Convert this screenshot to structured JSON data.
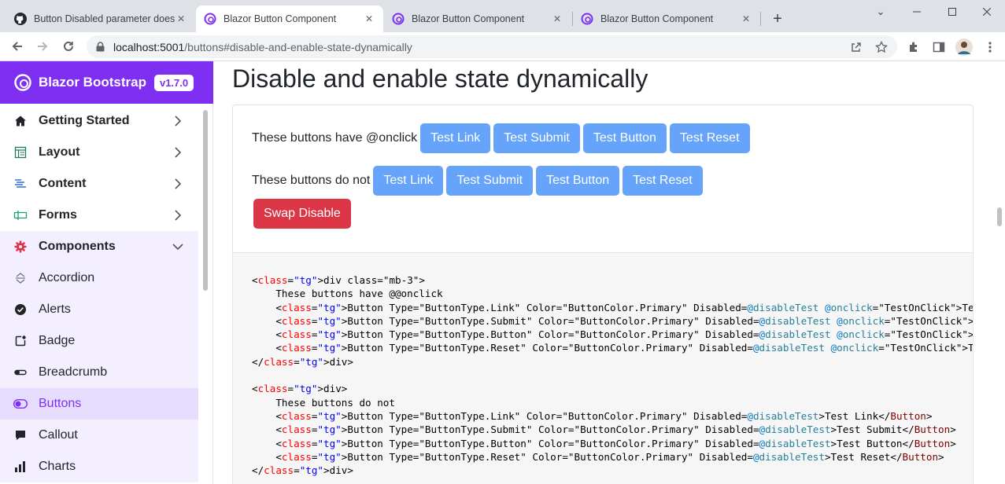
{
  "browser": {
    "tabs": [
      {
        "title": "Button Disabled parameter doesn't",
        "icon": "github-icon",
        "active": false
      },
      {
        "title": "Blazor Button Component",
        "icon": "blazor-icon",
        "active": true
      },
      {
        "title": "Blazor Button Component",
        "icon": "blazor-icon",
        "active": false
      },
      {
        "title": "Blazor Button Component",
        "icon": "blazor-icon",
        "active": false
      }
    ],
    "url_host": "localhost:5001",
    "url_path": "/buttons#disable-and-enable-state-dynamically"
  },
  "brand": {
    "name": "Blazor Bootstrap",
    "version": "v1.7.0",
    "color": "#7e2ff2"
  },
  "sidebar": {
    "items": [
      {
        "label": "Getting Started",
        "icon": "home-icon",
        "type": "group",
        "expanded": false
      },
      {
        "label": "Layout",
        "icon": "layout-icon",
        "type": "group",
        "expanded": false
      },
      {
        "label": "Content",
        "icon": "content-icon",
        "type": "group",
        "expanded": false
      },
      {
        "label": "Forms",
        "icon": "forms-icon",
        "type": "group",
        "expanded": false
      },
      {
        "label": "Components",
        "icon": "gear-icon",
        "type": "group",
        "expanded": true
      },
      {
        "label": "Accordion",
        "icon": "accordion-icon",
        "type": "sub"
      },
      {
        "label": "Alerts",
        "icon": "check-circle-icon",
        "type": "sub"
      },
      {
        "label": "Badge",
        "icon": "badge-icon",
        "type": "sub"
      },
      {
        "label": "Breadcrumb",
        "icon": "breadcrumb-icon",
        "type": "sub"
      },
      {
        "label": "Buttons",
        "icon": "toggle-icon",
        "type": "sub",
        "active": true
      },
      {
        "label": "Callout",
        "icon": "callout-icon",
        "type": "sub"
      },
      {
        "label": "Charts",
        "icon": "bar-chart-icon",
        "type": "sub"
      }
    ]
  },
  "main": {
    "title": "Disable and enable state dynamically",
    "row1_label": "These buttons have @onclick",
    "row2_label": "These buttons do not",
    "buttons": [
      "Test Link",
      "Test Submit",
      "Test Button",
      "Test Reset"
    ],
    "swap_label": "Swap Disable",
    "primary_color": "#66a3fa",
    "danger_color": "#dc3545",
    "code_lines": [
      "<div class=\"mb-3\">",
      "    These buttons have @@onclick",
      "    <Button Type=\"ButtonType.Link\" Color=\"ButtonColor.Primary\" Disabled=@disableTest @onclick=\"TestOnClick\">Test",
      "    <Button Type=\"ButtonType.Submit\" Color=\"ButtonColor.Primary\" Disabled=@disableTest @onclick=\"TestOnClick\">Tes",
      "    <Button Type=\"ButtonType.Button\" Color=\"ButtonColor.Primary\" Disabled=@disableTest @onclick=\"TestOnClick\">Tes",
      "    <Button Type=\"ButtonType.Reset\" Color=\"ButtonColor.Primary\" Disabled=@disableTest @onclick=\"TestOnClick\">Test",
      "</div>",
      "",
      "<div>",
      "    These buttons do not",
      "    <Button Type=\"ButtonType.Link\" Color=\"ButtonColor.Primary\" Disabled=@disableTest>Test Link</Button>",
      "    <Button Type=\"ButtonType.Submit\" Color=\"ButtonColor.Primary\" Disabled=@disableTest>Test Submit</Button>",
      "    <Button Type=\"ButtonType.Button\" Color=\"ButtonColor.Primary\" Disabled=@disableTest>Test Button</Button>",
      "    <Button Type=\"ButtonType.Reset\" Color=\"ButtonColor.Primary\" Disabled=@disableTest>Test Reset</Button>",
      "</div>"
    ]
  }
}
